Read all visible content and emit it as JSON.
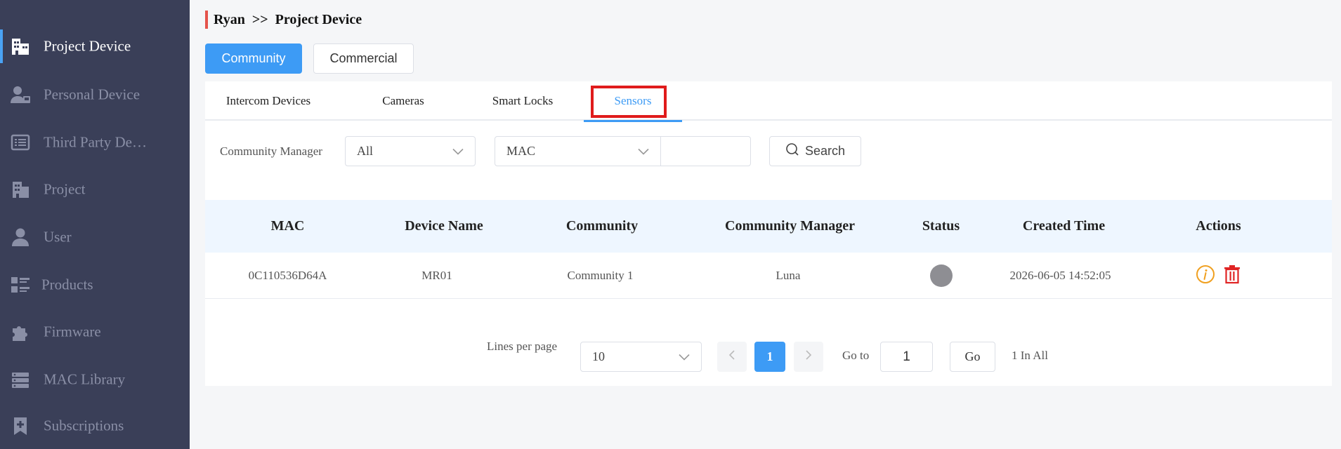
{
  "sidebar": {
    "items": [
      {
        "label": "Project Device",
        "icon": "building-icon",
        "active": true
      },
      {
        "label": "Personal Device",
        "icon": "person-device-icon"
      },
      {
        "label": "Third Party De…",
        "icon": "list-panel-icon"
      },
      {
        "label": "Project",
        "icon": "office-building-icon"
      },
      {
        "label": "User",
        "icon": "user-icon"
      },
      {
        "label": "Products",
        "icon": "products-icon"
      },
      {
        "label": "Firmware",
        "icon": "puzzle-icon"
      },
      {
        "label": "MAC Library",
        "icon": "server-icon"
      },
      {
        "label": "Subscriptions",
        "icon": "bookmark-add-icon"
      }
    ]
  },
  "breadcrumb": {
    "parent": "Ryan",
    "separator": ">>",
    "current": "Project Device"
  },
  "top_tabs": {
    "community": "Community",
    "commercial": "Commercial"
  },
  "sub_tabs": [
    "Intercom Devices",
    "Cameras",
    "Smart Locks",
    "Sensors"
  ],
  "filters": {
    "manager_label": "Community Manager",
    "manager_value": "All",
    "field_value": "MAC",
    "search_value": "",
    "search_button": "Search"
  },
  "table": {
    "headers": [
      "MAC",
      "Device Name",
      "Community",
      "Community Manager",
      "Status",
      "Created Time",
      "Actions"
    ],
    "rows": [
      {
        "mac": "0C110536D64A",
        "device_name": "MR01",
        "community": "Community 1",
        "manager": "Luna",
        "status": "offline",
        "created": "2026-06-05 14:52:05"
      }
    ]
  },
  "pagination": {
    "lines_label": "Lines per page",
    "lines_value": "10",
    "current_page": "1",
    "goto_label": "Go to",
    "goto_value": "1",
    "go_button": "Go",
    "total": "1 In All"
  },
  "colors": {
    "primary": "#3d9bf5",
    "sidebar": "#3a3f58",
    "warning": "#f0a020",
    "danger": "#e02424",
    "highlight": "#e01b1b"
  }
}
